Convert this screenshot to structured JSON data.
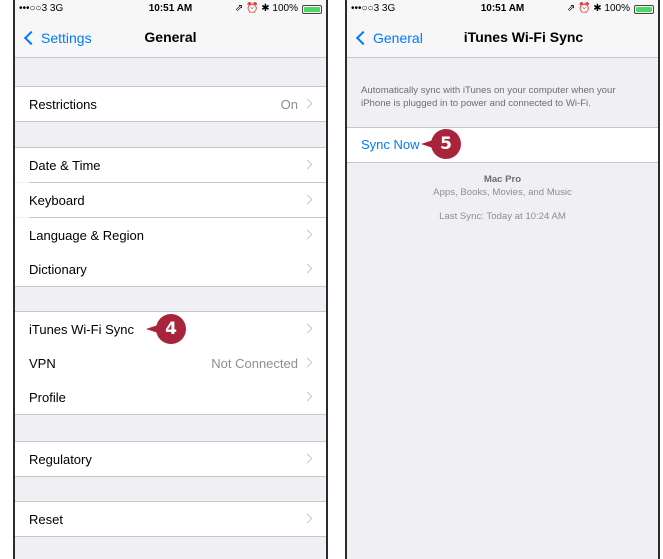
{
  "left_screen": {
    "status": {
      "carrier": "•••○○3  3G",
      "time": "10:51 AM",
      "indicators": "⇗ ⏰ ✱ 100%"
    },
    "nav": {
      "back_label": "Settings",
      "title": "General"
    },
    "rows": {
      "restrictions": {
        "label": "Restrictions",
        "value": "On"
      },
      "date_time": {
        "label": "Date & Time"
      },
      "keyboard": {
        "label": "Keyboard"
      },
      "language_region": {
        "label": "Language & Region"
      },
      "dictionary": {
        "label": "Dictionary"
      },
      "itunes_wifi_sync": {
        "label": "iTunes Wi-Fi Sync"
      },
      "vpn": {
        "label": "VPN",
        "value": "Not Connected"
      },
      "profile": {
        "label": "Profile"
      },
      "regulatory": {
        "label": "Regulatory"
      },
      "reset": {
        "label": "Reset"
      }
    },
    "callout": "4"
  },
  "right_screen": {
    "status": {
      "carrier": "•••○○3  3G",
      "time": "10:51 AM",
      "indicators": "⇗ ⏰ ✱ 100%"
    },
    "nav": {
      "back_label": "General",
      "title": "iTunes Wi-Fi Sync"
    },
    "description_line1": "Automatically sync with iTunes on your computer when your",
    "description_line2": "iPhone is plugged in to power and connected to Wi-Fi.",
    "sync_now_label": "Sync Now",
    "callout": "5",
    "computer_name": "Mac Pro",
    "sync_contents": "Apps, Books, Movies, and Music",
    "last_sync": "Last Sync: Today at 10:24 AM"
  },
  "colors": {
    "accent": "#007aff",
    "callout": "#a8243b",
    "background": "#efeff4"
  }
}
